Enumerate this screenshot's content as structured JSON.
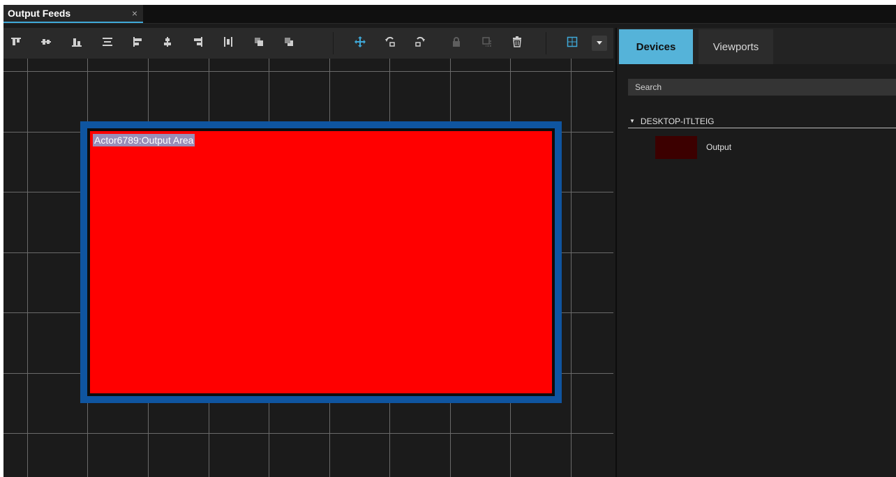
{
  "tabs": {
    "output_feeds": "Output Feeds",
    "close": "×"
  },
  "canvas": {
    "actor_label": "Actor6789:Output Area"
  },
  "panel": {
    "tabs": {
      "devices": "Devices",
      "viewports": "Viewports"
    },
    "search_placeholder": "Search",
    "group_name": "DESKTOP-ITLTEIG",
    "device_item": "Output"
  },
  "colors": {
    "accent": "#55b3d9",
    "active_icon": "#3fa9d9",
    "frame": "#0f55a0",
    "output_fill": "#ff0000"
  },
  "toolbar_icons": [
    "align-top-icon",
    "align-vertical-center-icon",
    "align-bottom-icon",
    "align-horizontal-center-icon",
    "align-left-icon",
    "align-center-icon",
    "align-right-icon",
    "distribute-icon",
    "bring-forward-icon",
    "send-backward-icon",
    "move-icon",
    "rotate-left-icon",
    "rotate-right-icon",
    "lock-icon",
    "duplicate-icon",
    "delete-icon",
    "grid-icon",
    "chevron-down-icon"
  ]
}
